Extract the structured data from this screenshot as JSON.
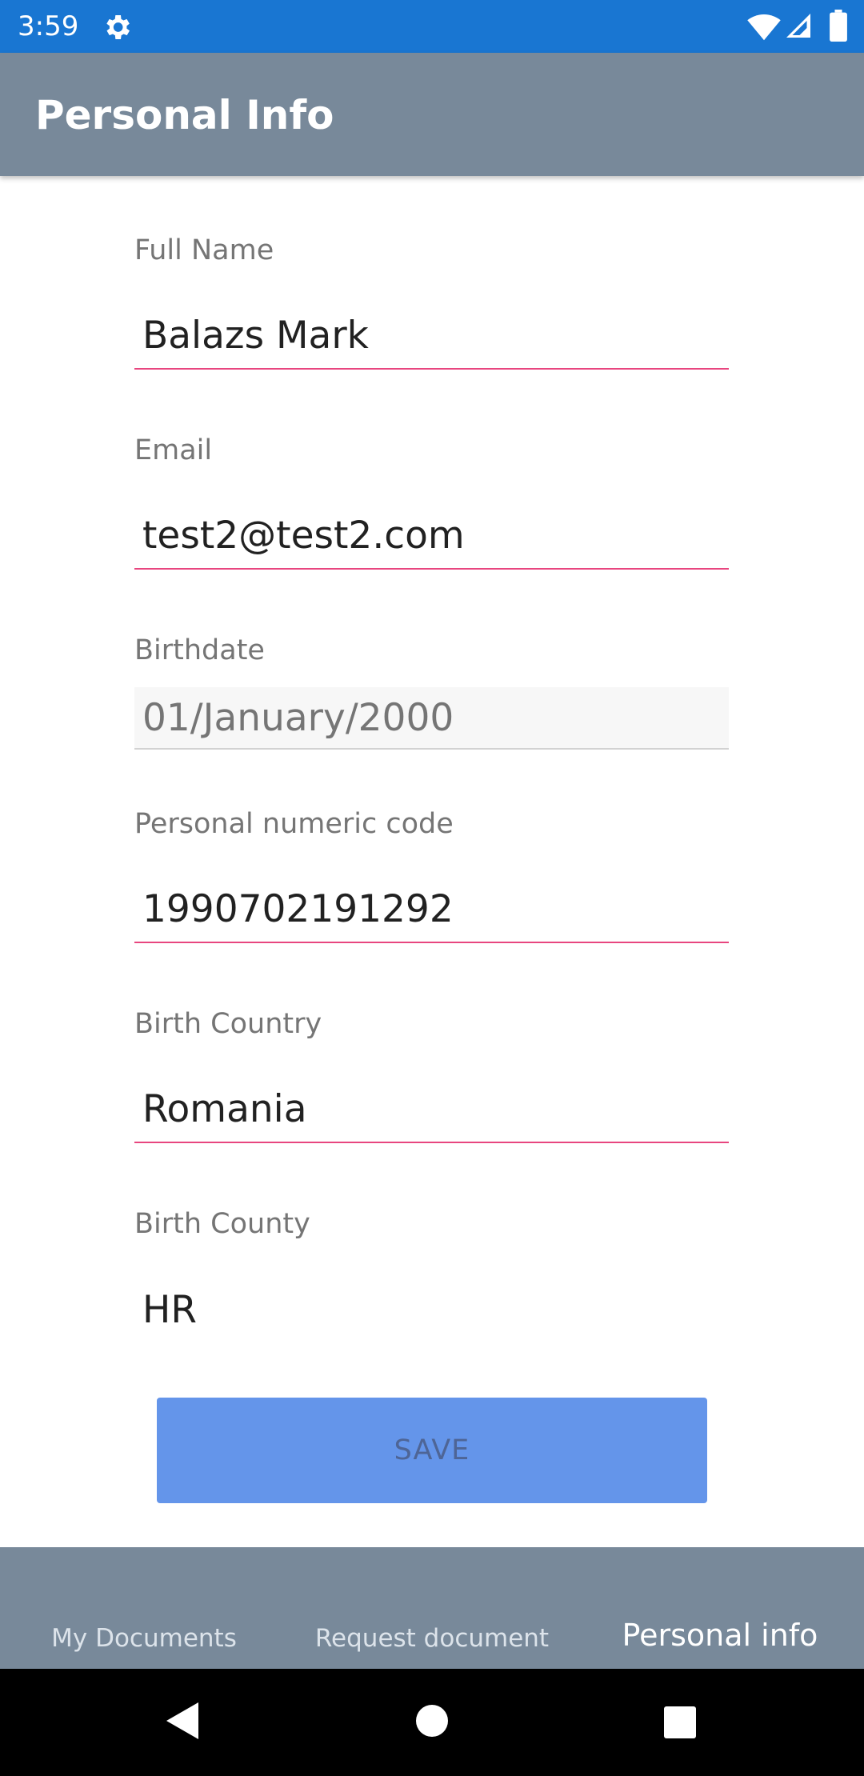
{
  "status_bar": {
    "time": "3:59",
    "icons": [
      "gear-icon",
      "wifi-icon",
      "cell-signal-icon",
      "battery-icon"
    ]
  },
  "app_bar": {
    "title": "Personal Info"
  },
  "form": {
    "full_name": {
      "label": "Full Name",
      "value": "Balazs Mark"
    },
    "email": {
      "label": "Email",
      "value": "test2@test2.com"
    },
    "birthdate": {
      "label": "Birthdate",
      "value": "01/January/2000"
    },
    "personal_numeric_code": {
      "label": "Personal numeric code",
      "value": "1990702191292"
    },
    "birth_country": {
      "label": "Birth Country",
      "value": "Romania"
    },
    "birth_county": {
      "label": "Birth County",
      "value": "HR"
    }
  },
  "save_button": {
    "label": "SAVE"
  },
  "bottom_nav": {
    "tabs": [
      {
        "label": "My Documents"
      },
      {
        "label": "Request document"
      },
      {
        "label": "Personal info"
      }
    ],
    "active": "Personal info"
  },
  "system_nav": {
    "icons": [
      "back-icon",
      "home-icon",
      "recents-icon"
    ]
  },
  "colors": {
    "status_bar": "#1976D2",
    "app_bar": "#78899A",
    "accent_underline": "#E8467F",
    "save_button": "#6495EA"
  }
}
